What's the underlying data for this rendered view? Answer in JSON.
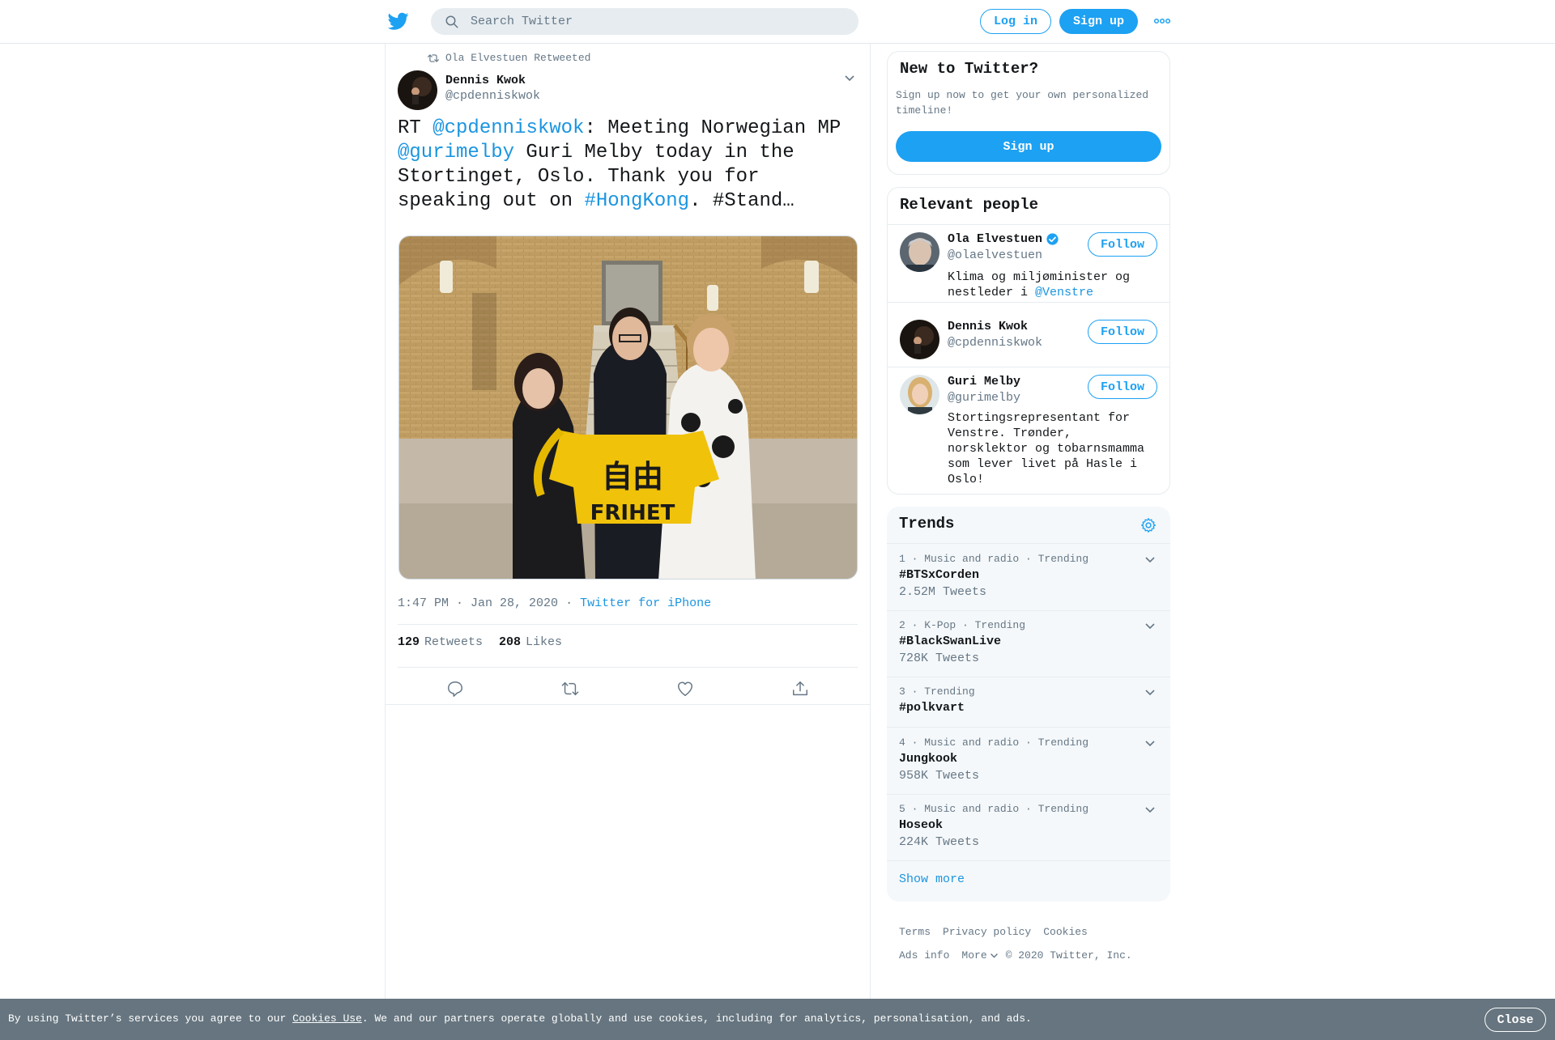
{
  "header": {
    "search_placeholder": "Search Twitter",
    "login_label": "Log in",
    "signup_label": "Sign up",
    "brand_color": "#1da1f2"
  },
  "tweet": {
    "retweet_context": "Ola Elvestuen Retweeted",
    "author_name": "Dennis Kwok",
    "author_handle": "@cpdenniskwok",
    "text_parts": {
      "p1": "RT ",
      "m1": "@cpdenniskwok",
      "p2": ": Meeting Norwegian MP ",
      "m2": "@gurimelby",
      "p3": " Guri Melby today in the Stortinget, Oslo. Thank you for speaking out on ",
      "h1": "#HongKong",
      "p4": ". #Stand…"
    },
    "photo_text": "自由 FRIHET",
    "timestamp": "1:47 PM · Jan 28, 2020",
    "separator": "·",
    "source": "Twitter for iPhone",
    "retweets_count": "129",
    "retweets_label": "Retweets",
    "likes_count": "208",
    "likes_label": "Likes"
  },
  "new_to_twitter": {
    "title": "New to Twitter?",
    "text": "Sign up now to get your own personalized timeline!",
    "signup_label": "Sign up"
  },
  "relevant_people": {
    "title": "Relevant people",
    "follow_label": "Follow",
    "people": [
      {
        "name": "Ola Elvestuen",
        "handle": "@olaelvestuen",
        "bio_pre": "Klima og miljøminister og nestleder i ",
        "bio_link": "@Venstre",
        "verified": true
      },
      {
        "name": "Dennis Kwok",
        "handle": "@cpdenniskwok"
      },
      {
        "name": "Guri Melby",
        "handle": "@gurimelby",
        "bio": "Stortingsrepresentant for Venstre. Trønder, norsklektor og tobarnsmamma som lever livet på Hasle i Oslo!"
      }
    ]
  },
  "trends": {
    "title": "Trends",
    "items": [
      {
        "meta": "1 · Music and radio · Trending",
        "name": "#BTSxCorden",
        "count": "2.52M Tweets"
      },
      {
        "meta": "2 · K-Pop · Trending",
        "name": "#BlackSwanLive",
        "count": "728K Tweets"
      },
      {
        "meta": "3 · Trending",
        "name": "#polkvart"
      },
      {
        "meta": "4 · Music and radio · Trending",
        "name": "Jungkook",
        "count": "958K Tweets"
      },
      {
        "meta": "5 · Music and radio · Trending",
        "name": "Hoseok",
        "count": "224K Tweets"
      }
    ],
    "show_more": "Show more"
  },
  "footer": {
    "terms": "Terms",
    "privacy": "Privacy policy",
    "cookies": "Cookies",
    "ads_info": "Ads info",
    "more": "More",
    "copyright": "© 2020 Twitter, Inc."
  },
  "cookie_bar": {
    "pre": "By using Twitter’s services you agree to our ",
    "link": "Cookies Use",
    "post": ". We and our partners operate globally and use cookies, including for analytics, personalisation, and ads.",
    "close_label": "Close"
  }
}
